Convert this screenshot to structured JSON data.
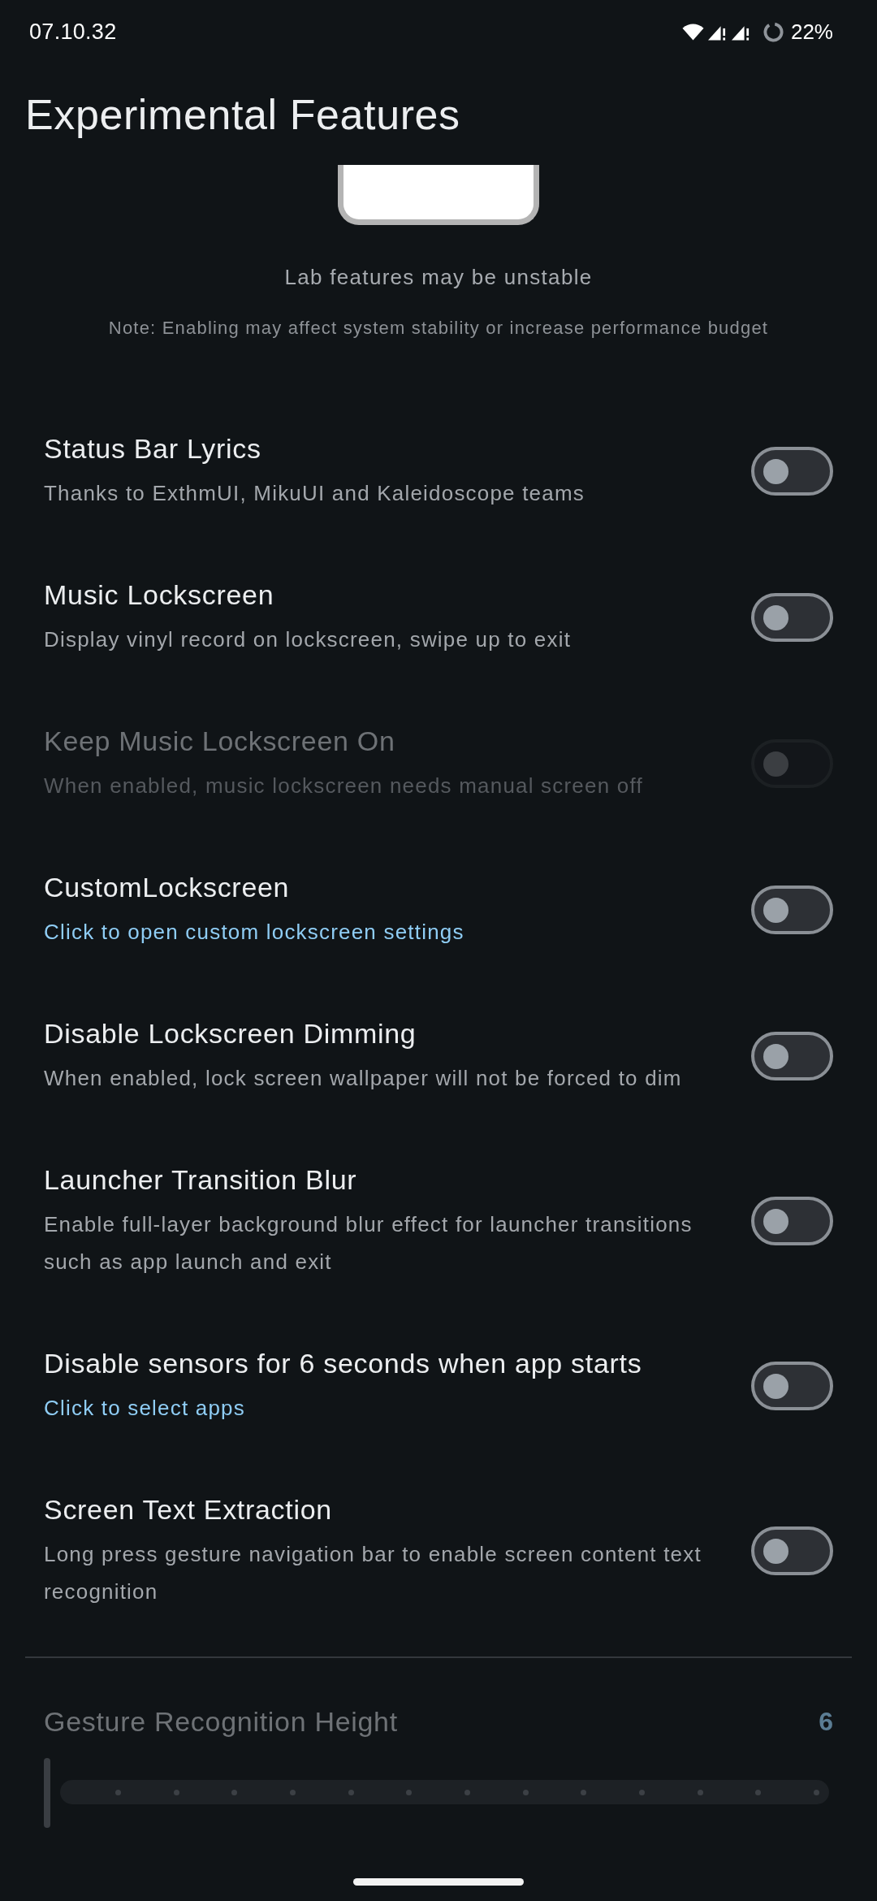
{
  "status_bar": {
    "time": "07.10.32",
    "battery": "22%"
  },
  "header": {
    "title": "Experimental Features"
  },
  "intro": {
    "caption": "Lab features may be unstable",
    "note": "Note: Enabling may affect system stability or increase performance budget"
  },
  "settings": [
    {
      "title": "Status Bar Lyrics",
      "description": "Thanks to ExthmUI, MikuUI and Kaleidoscope teams",
      "link": false,
      "on": false,
      "disabled": false
    },
    {
      "title": "Music Lockscreen",
      "description": "Display vinyl record on lockscreen, swipe up to exit",
      "link": false,
      "on": false,
      "disabled": false
    },
    {
      "title": "Keep Music Lockscreen On",
      "description": "When enabled, music lockscreen needs manual screen off",
      "link": false,
      "on": false,
      "disabled": true
    },
    {
      "title": "CustomLockscreen",
      "description": "Click to open custom lockscreen settings",
      "link": true,
      "on": false,
      "disabled": false
    },
    {
      "title": "Disable Lockscreen Dimming",
      "description": "When enabled, lock screen wallpaper will not be forced to dim",
      "link": false,
      "on": false,
      "disabled": false
    },
    {
      "title": "Launcher Transition Blur",
      "description": "Enable full-layer background blur effect for launcher transitions such as app launch and exit",
      "link": false,
      "on": false,
      "disabled": false
    },
    {
      "title": "Disable sensors for 6 seconds when app starts",
      "description": "Click to select apps",
      "link": true,
      "on": false,
      "disabled": false
    },
    {
      "title": "Screen Text Extraction",
      "description": "Long press gesture navigation bar to enable screen content text recognition",
      "link": false,
      "on": false,
      "disabled": false
    }
  ],
  "slider": {
    "title": "Gesture Recognition Height",
    "value": "6",
    "level": 0,
    "disabled": true
  }
}
